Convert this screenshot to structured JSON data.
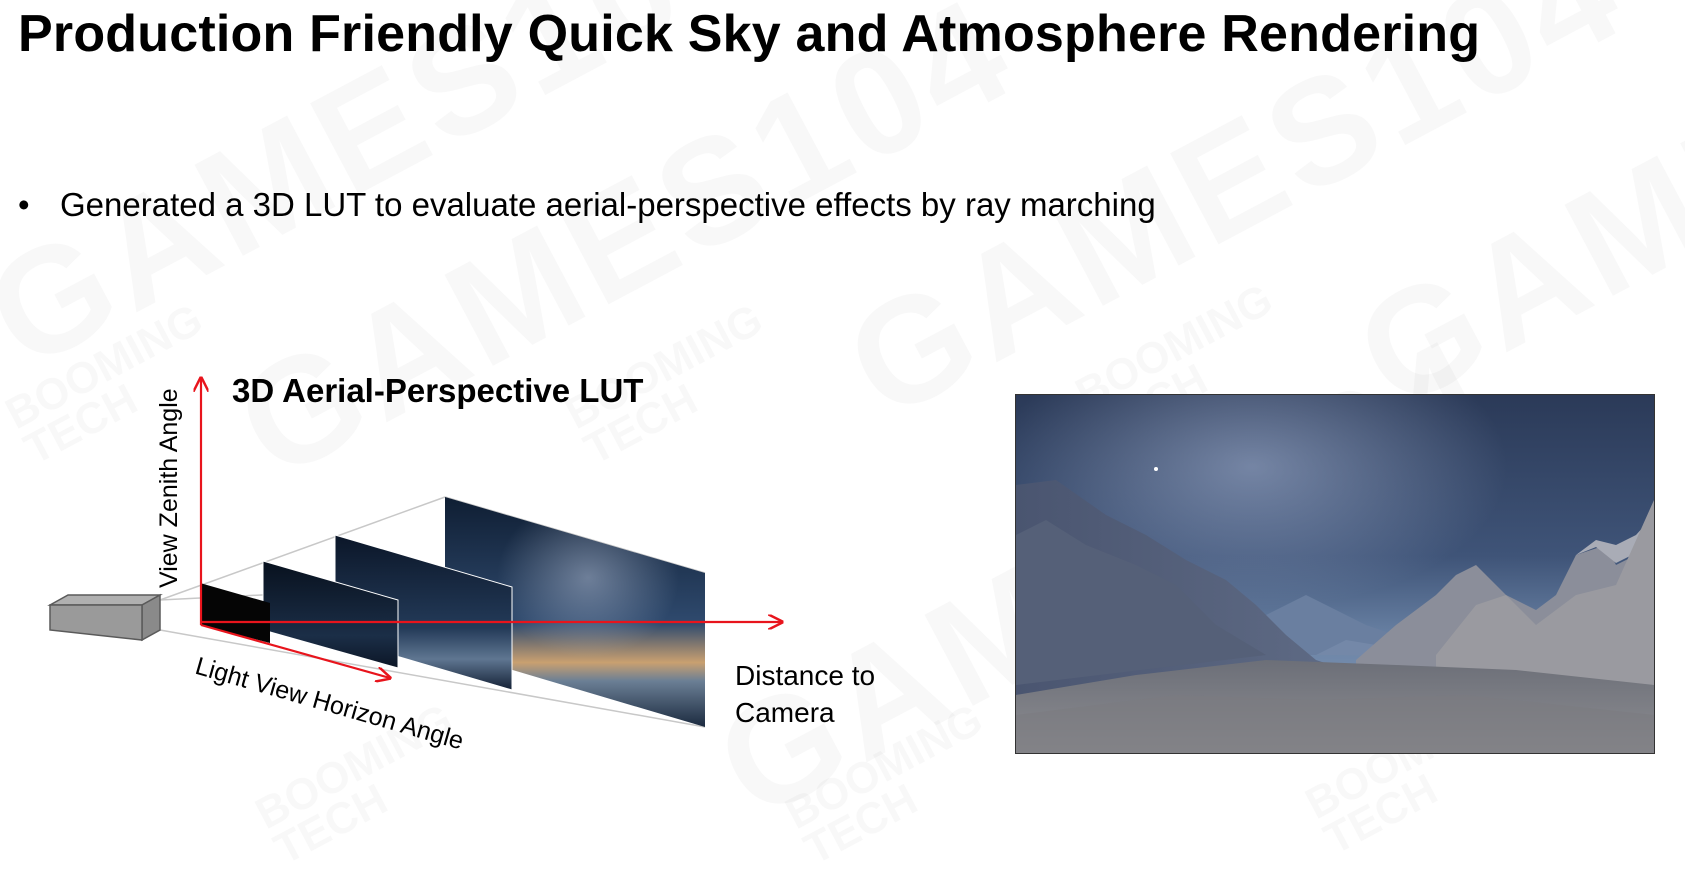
{
  "slide": {
    "title": "Production Friendly Quick Sky and Atmosphere Rendering",
    "bullets": [
      "Generated a 3D LUT to evaluate aerial-perspective effects by ray marching"
    ]
  },
  "diagram": {
    "title": "3D Aerial-Perspective LUT",
    "axis_vertical": "View Zenith Angle",
    "axis_diagonal": "Light View Horizon Angle",
    "axis_depth": "Distance to Camera",
    "axis_color": "#e8141c"
  },
  "watermark": {
    "big": "GAMES104",
    "small_line1": "BOOMING",
    "small_line2": "TECH"
  }
}
